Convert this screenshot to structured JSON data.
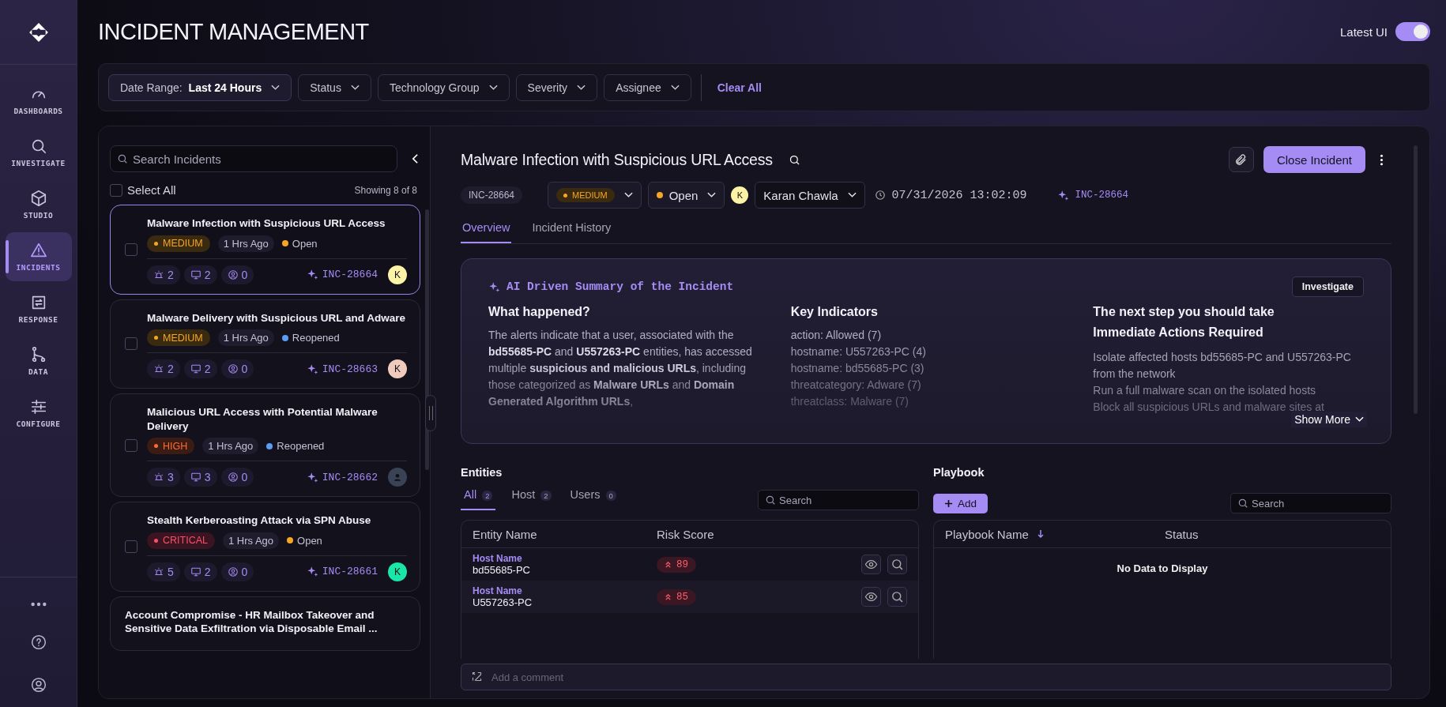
{
  "nav": {
    "items": [
      {
        "label": "DASHBOARDS",
        "kind": "gauge",
        "selected": false
      },
      {
        "label": "INVESTIGATE",
        "kind": "search",
        "selected": false
      },
      {
        "label": "STUDIO",
        "kind": "cube",
        "selected": false
      },
      {
        "label": "INCIDENTS",
        "kind": "alert",
        "selected": true
      },
      {
        "label": "RESPONSE",
        "kind": "response",
        "selected": false
      },
      {
        "label": "DATA",
        "kind": "branch",
        "selected": false
      },
      {
        "label": "CONFIGURE",
        "kind": "sliders",
        "selected": false
      }
    ]
  },
  "page_title": "INCIDENT MANAGEMENT",
  "latest_ui": {
    "label": "Latest UI",
    "on": true
  },
  "filters": [
    {
      "label": "Date Range:",
      "value": "Last 24 Hours"
    },
    {
      "label": "Status"
    },
    {
      "label": "Technology Group"
    },
    {
      "label": "Severity"
    },
    {
      "label": "Assignee"
    }
  ],
  "clear_all": "Clear All",
  "incident_list": {
    "search_placeholder": "Search Incidents",
    "select_all": {
      "label": "Select All",
      "checked": false
    },
    "showing": "Showing 8 of 8",
    "items": [
      {
        "title": "Malware Infection with Suspicious URL Access",
        "severity": {
          "label": "MEDIUM",
          "kind": "medium"
        },
        "age": "1 Hrs Ago",
        "status": {
          "label": "Open",
          "color": "#f5a623"
        },
        "alerts": "2",
        "hosts": "2",
        "users": "0",
        "id": "INC-28664",
        "avatar": {
          "kind": "letter",
          "letter": "K",
          "color": "#fdf3a7"
        },
        "selected": true,
        "checked": false
      },
      {
        "title": "Malware Delivery with Suspicious URL and Adware",
        "severity": {
          "label": "MEDIUM",
          "kind": "medium"
        },
        "age": "1 Hrs Ago",
        "status": {
          "label": "Reopened",
          "color": "#5b9cf5"
        },
        "alerts": "2",
        "hosts": "2",
        "users": "0",
        "id": "INC-28663",
        "avatar": {
          "kind": "letter",
          "letter": "K",
          "color": "#f0cbbd"
        },
        "selected": false,
        "checked": false
      },
      {
        "title": "Malicious URL Access with Potential Malware Delivery",
        "severity": {
          "label": "HIGH",
          "kind": "high"
        },
        "age": "1 Hrs Ago",
        "status": {
          "label": "Reopened",
          "color": "#5b9cf5"
        },
        "alerts": "3",
        "hosts": "3",
        "users": "0",
        "id": "INC-28662",
        "avatar": {
          "kind": "person",
          "color": "#3a4256"
        },
        "selected": false,
        "checked": false
      },
      {
        "title": "Stealth Kerberoasting Attack via SPN Abuse",
        "severity": {
          "label": "CRITICAL",
          "kind": "critical"
        },
        "age": "1 Hrs Ago",
        "status": {
          "label": "Open",
          "color": "#f5a623"
        },
        "alerts": "5",
        "hosts": "2",
        "users": "0",
        "id": "INC-28661",
        "avatar": {
          "kind": "letter",
          "letter": "K",
          "color": "#19e6a8"
        },
        "selected": false,
        "checked": false
      },
      {
        "title": "Account Compromise - HR Mailbox Takeover and Sensitive Data Exfiltration via Disposable Email ...",
        "selected": false
      }
    ]
  },
  "detail": {
    "title": "Malware Infection with Suspicious URL Access",
    "close_button": "Close Incident",
    "id_badge": "INC-28664",
    "severity": {
      "label": "MEDIUM",
      "kind": "medium"
    },
    "status": {
      "label": "Open",
      "color": "#f5a623"
    },
    "assignee": {
      "letter": "K",
      "name": "Karan Chawla",
      "color": "#fdf3a7"
    },
    "datetime": "07/31/2026 13:02:09",
    "ref_id": "INC-28664",
    "tabs": [
      {
        "label": "Overview",
        "selected": true
      },
      {
        "label": "Incident History",
        "selected": false
      }
    ],
    "summary": {
      "title": "AI Driven Summary of the Incident",
      "button": "Investigate",
      "what_happened": {
        "heading": "What happened?",
        "text": "The alerts indicate that a user, associated with the **bd55685-PC** and **U557263-PC** entities, has accessed multiple **suspicious and malicious URLs**, including those categorized as **Malware URLs** and **Domain Generated Algorithm URLs**,"
      },
      "key_indicators": {
        "heading": "Key Indicators",
        "items": [
          "action: Allowed (7)",
          "hostname: U557263-PC (4)",
          "hostname: bd55685-PC (3)",
          "threatcategory: Adware (7)",
          "threatclass: Malware (7)"
        ]
      },
      "next_step": {
        "heading": "The next step you should take",
        "subheading": "Immediate Actions Required",
        "items": [
          "Isolate affected hosts bd55685-PC and U557263-PC from the network",
          "Run a full malware scan on the isolated hosts",
          "Block all suspicious URLs and malware sites at"
        ]
      },
      "show_more": "Show More"
    },
    "entities": {
      "heading": "Entities",
      "tabs": [
        {
          "label": "All",
          "count": "2",
          "selected": true
        },
        {
          "label": "Host",
          "count": "2",
          "selected": false
        },
        {
          "label": "Users",
          "count": "0",
          "selected": false
        }
      ],
      "search_placeholder": "Search",
      "columns": [
        "Entity Name",
        "Risk Score"
      ],
      "rows": [
        {
          "type": "Host Name",
          "name": "bd55685-PC",
          "risk": "89"
        },
        {
          "type": "Host Name",
          "name": "U557263-PC",
          "risk": "85"
        }
      ]
    },
    "playbook": {
      "heading": "Playbook",
      "add_button": "Add",
      "search_placeholder": "Search",
      "columns": [
        "Playbook Name",
        "Status"
      ],
      "empty": "No Data to Display"
    },
    "comment_placeholder": "Add a comment"
  }
}
